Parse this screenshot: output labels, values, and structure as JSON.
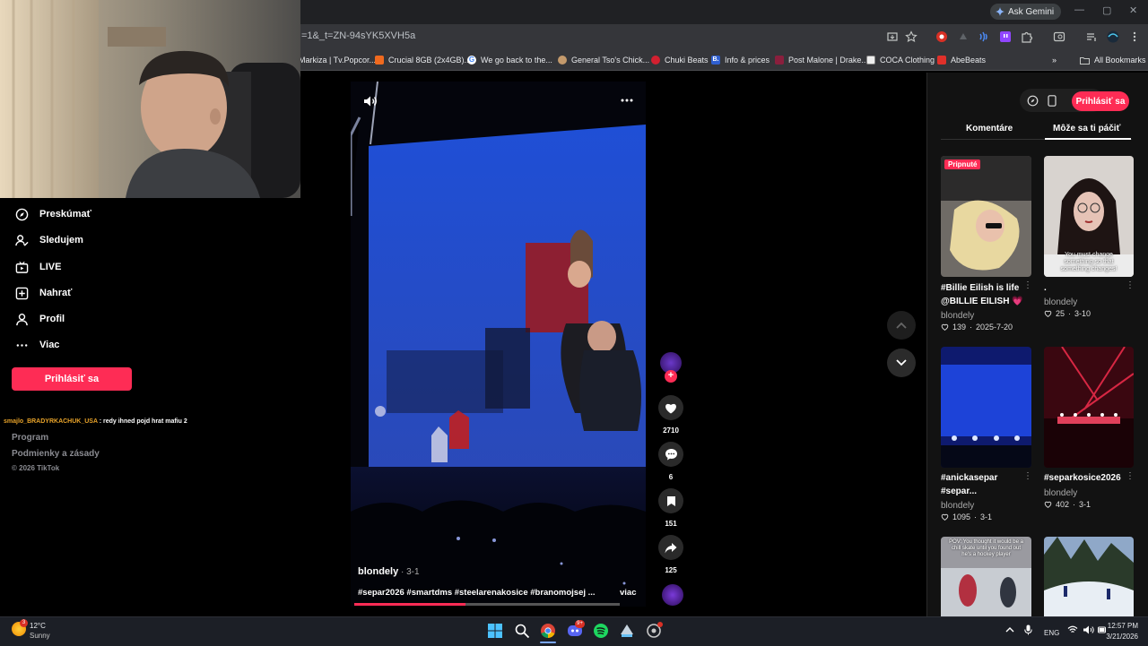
{
  "browser": {
    "url_fragment": "=1&_t=ZN-94sYK5XVH5a",
    "ask_gemini": "Ask Gemini",
    "bookmarks": [
      {
        "label": "Markiza | Tv.Popcor...",
        "color": "#e03a3a"
      },
      {
        "label": "Crucial 8GB (2x4GB)...",
        "color": "#f06a1f"
      },
      {
        "label": "We go back to the...",
        "color": "#4285f4"
      },
      {
        "label": "General Tso's Chick...",
        "color": "#c49a6c"
      },
      {
        "label": "Chuki Beats",
        "color": "#d22030"
      },
      {
        "label": "Info & prices",
        "color": "#2f5fd0"
      },
      {
        "label": "Post Malone | Drake...",
        "color": "#8a1f3d"
      },
      {
        "label": "COCA Clothing",
        "color": "#eeeeee"
      },
      {
        "label": "AbeBeats",
        "color": "#e0302a"
      }
    ],
    "all_bookmarks": "All Bookmarks",
    "bookmark_more": "»"
  },
  "sidebar": {
    "items": [
      {
        "label": "Preskúmať",
        "icon": "compass-icon"
      },
      {
        "label": "Sledujem",
        "icon": "following-icon"
      },
      {
        "label": "LIVE",
        "icon": "live-tv-icon"
      },
      {
        "label": "Nahrať",
        "icon": "upload-icon"
      },
      {
        "label": "Profil",
        "icon": "profile-icon"
      },
      {
        "label": "Viac",
        "icon": "more-icon"
      }
    ],
    "login": "Prihlásiť sa",
    "chat_user": "smajlo_BRADYRKACHUK_USA",
    "chat_message": " : redy ihned pojd hrat mafiu 2",
    "footer": {
      "program": "Program",
      "terms": "Podmienky a zásady",
      "copyright": "© 2026 TikTok"
    }
  },
  "video": {
    "author": "blondely",
    "date": " · 3-1",
    "caption": "#separ2026 #smartdms #steelarenakosice #branomojsej ...",
    "more": "viac",
    "likes": "2710",
    "comments": "6",
    "saves": "151",
    "shares": "125",
    "progress": 0.42
  },
  "right_panel": {
    "login": "Prihlásiť sa",
    "tabs": [
      "Komentáre",
      "Môže sa ti páčiť"
    ],
    "active_tab": 1,
    "cards": [
      {
        "badge": "Pripnuté",
        "title_line1": "#Billie Eilish is life",
        "title_line2": "@BILLIE EILISH ",
        "heart_emoji": "💗",
        "author": "blondely",
        "likes": "139",
        "date": "2025-7-20"
      },
      {
        "caption": "You must change something so that something changes!",
        "title_line1": ".",
        "author": "blondely",
        "likes": "25",
        "date": "3-10"
      },
      {
        "title_line1": "#anickasepar",
        "title_line2": "#separ...",
        "author": "blondely",
        "likes": "1095",
        "date": "3-1"
      },
      {
        "title_line1": "#separkosice2026",
        "author": "blondely",
        "likes": "402",
        "date": "3-1"
      },
      {
        "caption": "POV: You thought it would be a chill skate until you found out he's a hockey player"
      }
    ]
  },
  "taskbar": {
    "weather_temp": "12°C",
    "weather_desc": "Sunny",
    "weather_badge": "3",
    "discord_badge": "9+",
    "lang": "ENG",
    "time": "12:57 PM",
    "date": "3/21/2026"
  }
}
